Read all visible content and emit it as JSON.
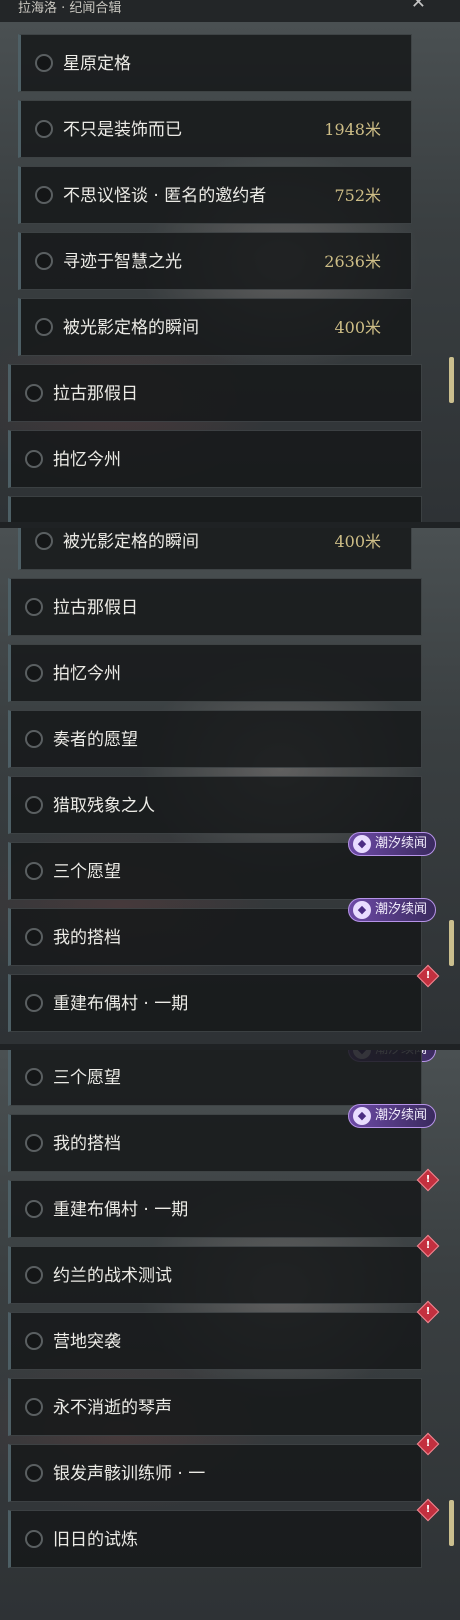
{
  "header": {
    "title": "拉海洛 · 纪闻合辑"
  },
  "panel1": {
    "rows": [
      {
        "label": "星原定格",
        "dist": ""
      },
      {
        "label": "不只是装饰而已",
        "dist": "1948米"
      },
      {
        "label": "不思议怪谈 · 匿名的邀约者",
        "dist": "752米"
      },
      {
        "label": "寻迹于智慧之光",
        "dist": "2636米"
      },
      {
        "label": "被光影定格的瞬间",
        "dist": "400米"
      },
      {
        "label": "拉古那假日",
        "dist": ""
      },
      {
        "label": "拍忆今州",
        "dist": ""
      }
    ]
  },
  "panel2": {
    "rows": [
      {
        "label": "被光影定格的瞬间",
        "dist": "400米"
      },
      {
        "label": "拉古那假日",
        "dist": ""
      },
      {
        "label": "拍忆今州",
        "dist": ""
      },
      {
        "label": "奏者的愿望",
        "dist": ""
      },
      {
        "label": "猎取残象之人",
        "dist": ""
      },
      {
        "label": "三个愿望",
        "dist": ""
      },
      {
        "label": "我的搭档",
        "dist": ""
      },
      {
        "label": "重建布偶村 · 一期",
        "dist": ""
      }
    ]
  },
  "panel3": {
    "rows": [
      {
        "label": "三个愿望",
        "dist": ""
      },
      {
        "label": "我的搭档",
        "dist": ""
      },
      {
        "label": "重建布偶村 · 一期",
        "dist": ""
      },
      {
        "label": "约兰的战术测试",
        "dist": ""
      },
      {
        "label": "营地突袭",
        "dist": ""
      },
      {
        "label": "永不消逝的琴声",
        "dist": ""
      },
      {
        "label": "银发声骸训练师 · 一",
        "dist": ""
      },
      {
        "label": "旧日的试炼",
        "dist": ""
      }
    ]
  },
  "badges": {
    "tide": "潮汐续闻",
    "alert": "!"
  },
  "colors": {
    "accent": "#cbbf8e",
    "tide": "#6d4aa6",
    "alert": "#c3303f"
  }
}
